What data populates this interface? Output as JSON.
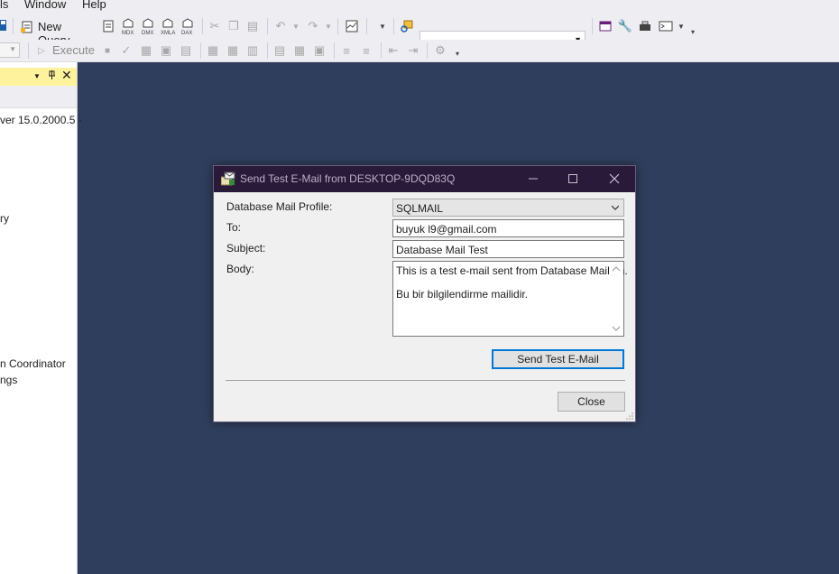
{
  "menu": {
    "items": [
      "ls",
      "Window",
      "Help"
    ]
  },
  "toolbar": {
    "new_query_label": "New Query",
    "mini_labels": [
      "MDX",
      "DMX",
      "XMLA",
      "DAX"
    ],
    "execute_label": "Execute",
    "combo_value": ""
  },
  "object_explorer": {
    "lines": [
      "ver 15.0.2000.5 -",
      "ry",
      "n Coordinator",
      "ngs"
    ]
  },
  "dialog": {
    "title": "Send Test E-Mail from DESKTOP-9DQD83Q",
    "profile_label": "Database Mail Profile:",
    "profile_value": "SQLMAIL",
    "to_label": "To:",
    "to_value": "buyuk       l9@gmail.com",
    "subject_label": "Subject:",
    "subject_value": "Database Mail Test",
    "body_label": "Body:",
    "body_lines": [
      "This is a test e-mail sent from Database Mail on.",
      "Bu bir bilgilendirme mailidir."
    ],
    "send_button": "Send Test E-Mail",
    "close_button": "Close"
  },
  "colors": {
    "workspace": "#2f3e5c",
    "dialog_titlebar": "#2a1a3a",
    "panel_header": "#fff29d",
    "focus_border": "#0078d7"
  }
}
